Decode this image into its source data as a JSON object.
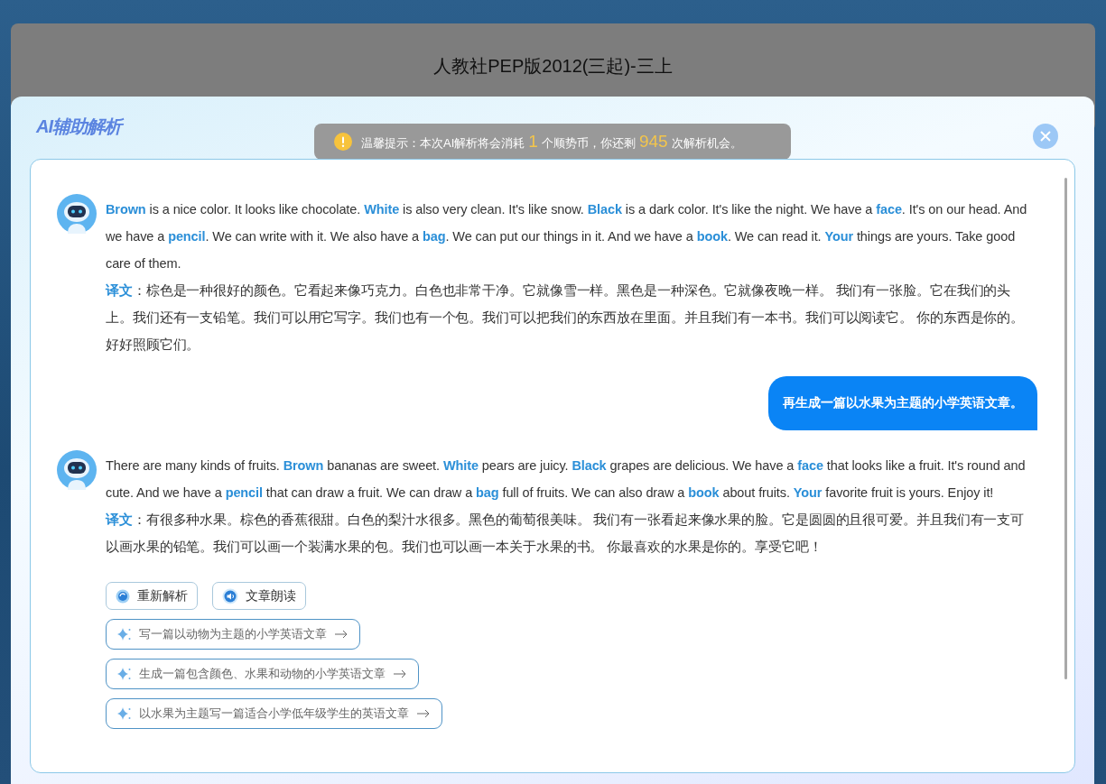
{
  "backdrop": {
    "title": "人教社PEP版2012(三起)-三上"
  },
  "panel": {
    "badge": "AI辅助解析",
    "notice": {
      "before": "温馨提示：本次AI解析将会消耗",
      "cost": "1",
      "middle": "个顺势币，你还剩",
      "remaining": "945",
      "after": "次解析机会。"
    }
  },
  "messages": [
    {
      "kind": "assistant",
      "text": "**Brown** is a nice color. It looks like chocolate. **White** is also very clean. It's like snow. **Black** is a dark color. It's like the night. We have a **face**. It's on our head. And we have a **pencil**. We can write with it. We also have a **bag**. We can put our things in it. And we have a **book**. We can read it. **Your** things are yours. Take good care of them.",
      "translation": "**译文**：棕色是一种很好的颜色。它看起来像巧克力。白色也非常干净。它就像雪一样。黑色是一种深色。它就像夜晚一样。 我们有一张脸。它在我们的头上。我们还有一支铅笔。我们可以用它写字。我们也有一个包。我们可以把我们的东西放在里面。并且我们有一本书。我们可以阅读它。 你的东西是你的。好好照顾它们。"
    },
    {
      "kind": "user",
      "text": "再生成一篇以水果为主题的小学英语文章。"
    },
    {
      "kind": "assistant",
      "text": "There are many kinds of fruits. **Brown** bananas are sweet. **White** pears are juicy. **Black** grapes are delicious. We have a **face** that looks like a fruit. It's round and cute. And we have a **pencil** that can draw a fruit. We can draw a **bag** full of fruits. We can also draw a **book** about fruits. **Your** favorite fruit is yours. Enjoy it!",
      "translation": "**译文**：有很多种水果。棕色的香蕉很甜。白色的梨汁水很多。黑色的葡萄很美味。 我们有一张看起来像水果的脸。它是圆圆的且很可爱。并且我们有一支可以画水果的铅笔。我们可以画一个装满水果的包。我们也可以画一本关于水果的书。 你最喜欢的水果是你的。享受它吧！"
    }
  ],
  "actions": [
    {
      "label": "重新解析",
      "kind": "refresh"
    },
    {
      "label": "文章朗读",
      "kind": "audio"
    }
  ],
  "suggestions": [
    "写一篇以动物为主题的小学英语文章",
    "生成一篇包含颜色、水果和动物的小学英语文章",
    "以水果为主题写一篇适合小学低年级学生的英语文章"
  ]
}
